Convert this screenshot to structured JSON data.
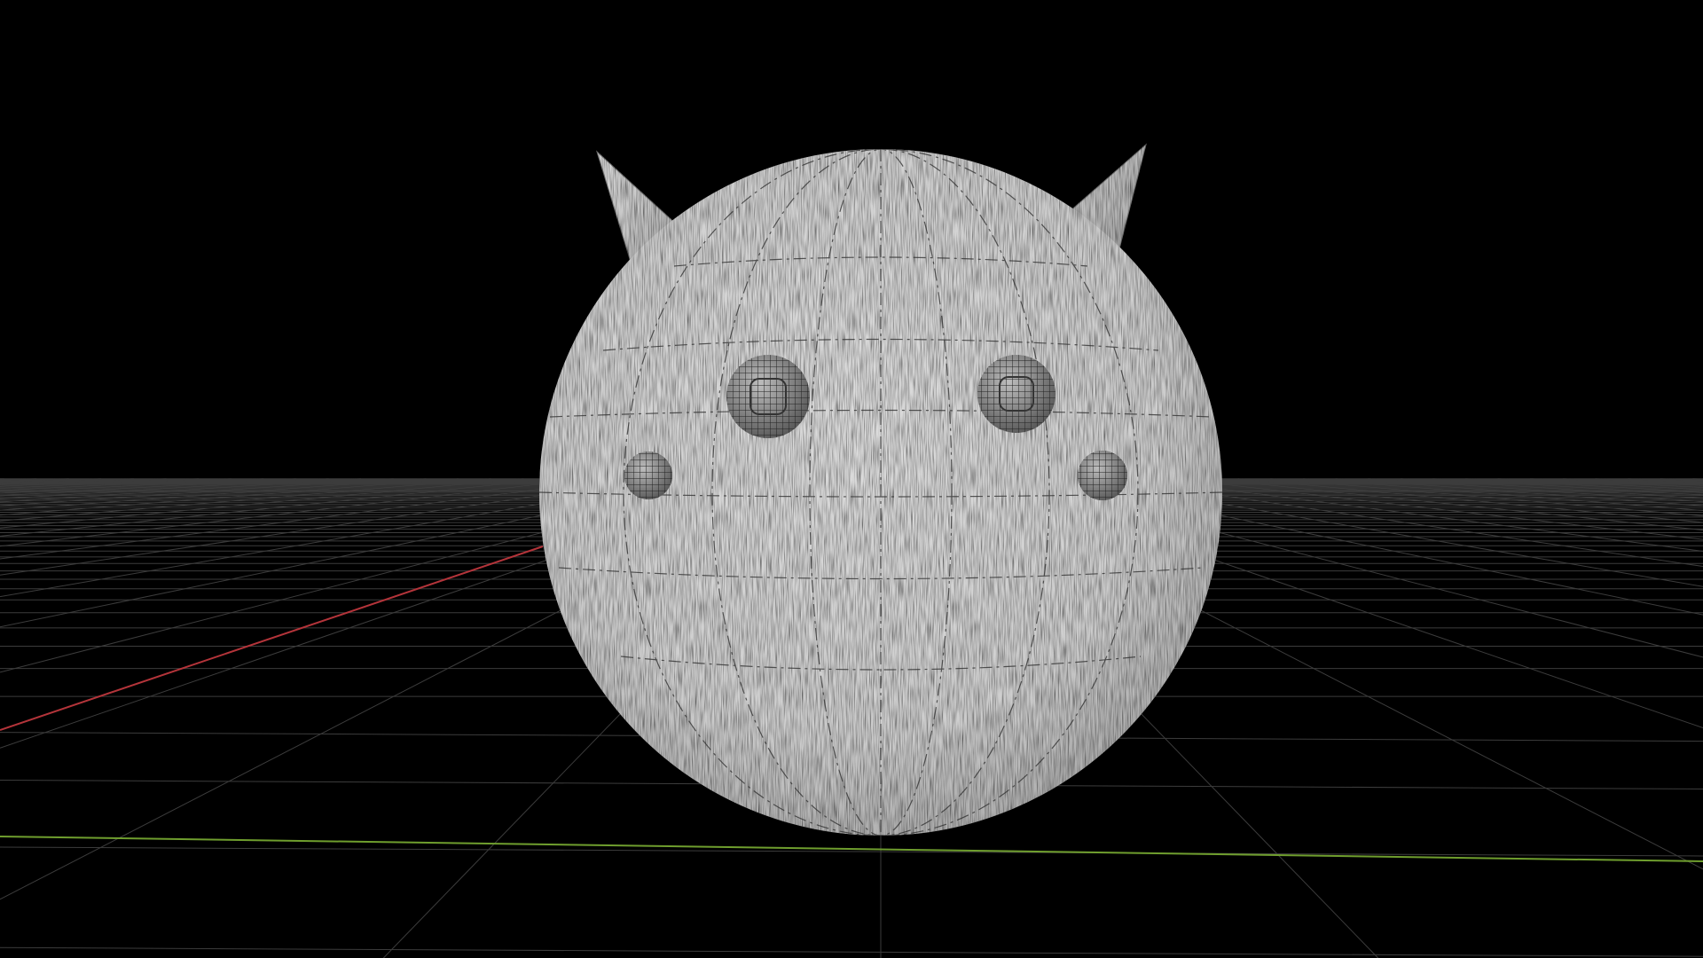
{
  "viewport": {
    "background": "#000000",
    "grid_color": "#3c3c3c",
    "x_axis_color": "#b4343a",
    "z_axis_color": "#6f9e2e",
    "model_color": "#d2d2d2",
    "wire_color": "#2a2a2a"
  }
}
